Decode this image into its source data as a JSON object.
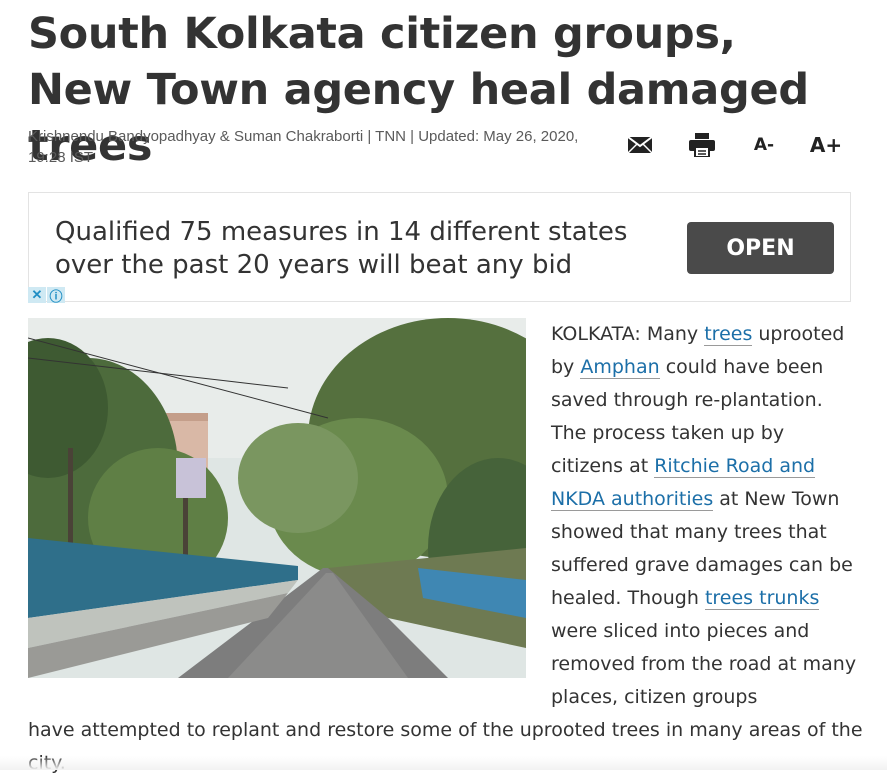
{
  "article": {
    "headline": "South Kolkata citizen groups, New Town agency heal damaged trees",
    "byline": "Krishnendu Bandyopadhyay & Suman Chakraborti | TNN | Updated: May 26, 2020, 19:28 IST"
  },
  "tools": {
    "email_icon": "envelope-icon",
    "print_icon": "printer-icon",
    "font_decrease_label": "A-",
    "font_increase_label": "A+"
  },
  "ad": {
    "text": "Qualified 75 measures in 14 different states over the past 20 years will beat any bid",
    "cta_label": "OPEN",
    "close_glyph": "✕",
    "info_glyph": "ⓘ"
  },
  "body": {
    "p1_a": "KOLKATA: Many ",
    "link_trees": "trees",
    "p1_b": " uprooted by ",
    "link_amphan": "Amphan",
    "p1_c": " could have been saved through re-plantation. The process taken up by citizens at ",
    "link_ritchie": "Ritchie Road and NKDA authorities",
    "p1_d": " at New Town showed that many trees that suffered grave damages can be healed. Though ",
    "link_trunks": "trees trunks",
    "p1_e": " were sliced into pieces and removed from the road at many places, citizen groups",
    "p1_f": "have attempted to replant and restore some of the uprooted trees in many areas of the city."
  },
  "colors": {
    "link": "#1c6fa8",
    "headline": "#333333",
    "cta_bg": "#4a4a4a",
    "ad_badge_bg": "#cfe9f3"
  }
}
